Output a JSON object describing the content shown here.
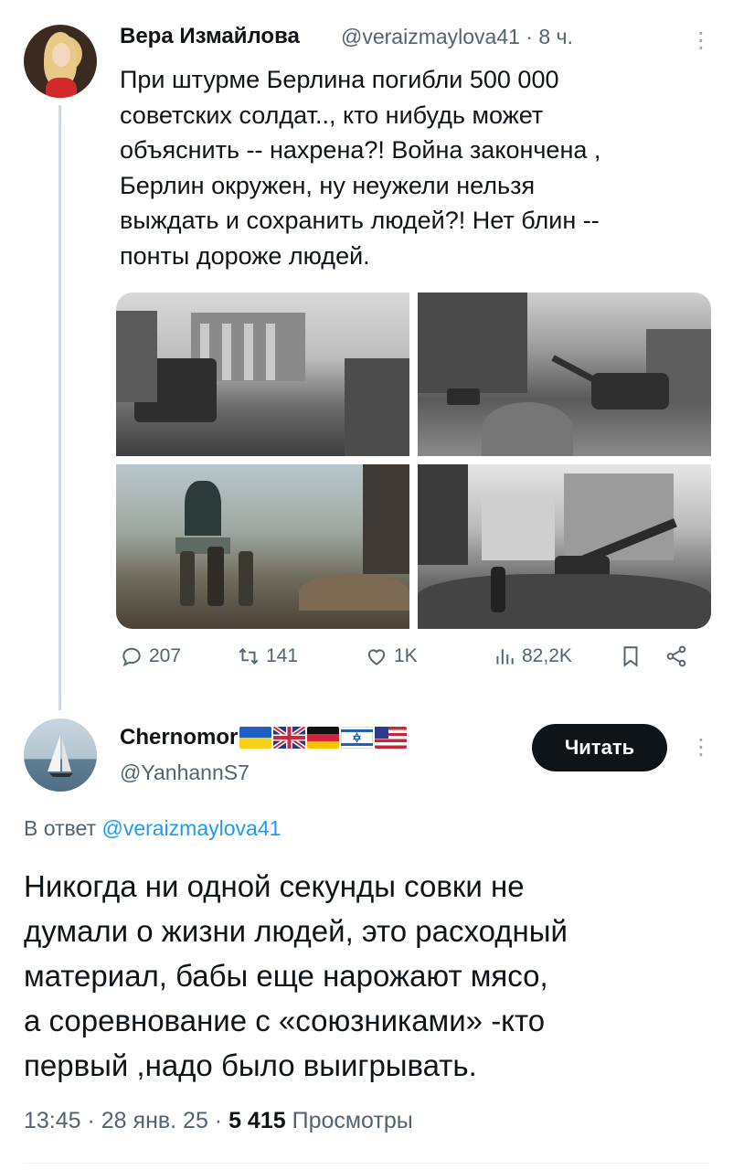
{
  "tweet": {
    "author_name": "Вера Измайлова",
    "handle_time": "@veraizmaylova41 · 8 ч.",
    "text": "При штурме Берлина погибли 500 000\nсоветских солдат.., кто нибудь может\nобъяснить -- нахрена?! Война закончена ,\nБерлин окружен, ну неужели нельзя\nвыждать и сохранить людей?! Нет блин --\nпонты дороже людей.",
    "stats": {
      "replies": "207",
      "reposts": "141",
      "likes": "1K",
      "views": "82,2K"
    }
  },
  "reply": {
    "author_name": "Chernomor",
    "handle": "@YanhannS7",
    "follow_label": "Читать",
    "reply_prefix": "В ответ",
    "reply_to_handle": "@veraizmaylova41",
    "text": "Никогда ни одной секунды совки не\nдумали о жизни людей, это расходный\nматериал, бабы еще нарожают мясо,\nа соревнование с «союзниками» -кто\nпервый ,надо было выигрывать.",
    "time": "13:45 · 28 янв. 25 · ",
    "views_count": "5 415",
    "views_label": "Просмотры"
  },
  "colors": {
    "text": "#0f1419",
    "secondary": "#536471",
    "link": "#1d9bf0",
    "button_bg": "#0f1419"
  }
}
